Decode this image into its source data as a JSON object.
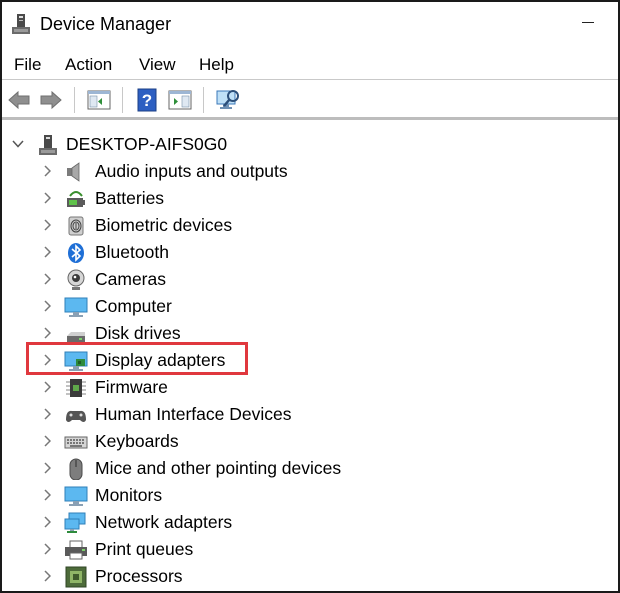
{
  "window": {
    "title": "Device Manager"
  },
  "menu": [
    {
      "key": "file",
      "label": "File"
    },
    {
      "key": "action",
      "label": "Action"
    },
    {
      "key": "view",
      "label": "View"
    },
    {
      "key": "help",
      "label": "Help"
    }
  ],
  "toolbar": [
    {
      "key": "back",
      "icon": "back-arrow-icon"
    },
    {
      "key": "forward",
      "icon": "forward-arrow-icon"
    },
    {
      "key": "show-hide-console-tree",
      "icon": "console-tree-icon"
    },
    {
      "key": "help",
      "icon": "help-icon"
    },
    {
      "key": "properties",
      "icon": "properties-icon"
    },
    {
      "key": "scan-for-hardware-changes",
      "icon": "scan-monitor-icon"
    }
  ],
  "tree": {
    "root": {
      "label": "DESKTOP-AIFS0G0",
      "expanded": true,
      "icon": "computer-tower-icon"
    },
    "items": [
      {
        "key": "audio",
        "label": "Audio inputs and outputs",
        "icon": "speaker-icon"
      },
      {
        "key": "batteries",
        "label": "Batteries",
        "icon": "battery-icon"
      },
      {
        "key": "biometric",
        "label": "Biometric devices",
        "icon": "fingerprint-icon"
      },
      {
        "key": "bluetooth",
        "label": "Bluetooth",
        "icon": "bluetooth-icon"
      },
      {
        "key": "cameras",
        "label": "Cameras",
        "icon": "camera-icon"
      },
      {
        "key": "computer",
        "label": "Computer",
        "icon": "monitor-icon"
      },
      {
        "key": "disk",
        "label": "Disk drives",
        "icon": "disk-drive-icon"
      },
      {
        "key": "display",
        "label": "Display adapters",
        "icon": "display-adapter-icon",
        "highlighted": true
      },
      {
        "key": "firmware",
        "label": "Firmware",
        "icon": "chip-icon"
      },
      {
        "key": "hid",
        "label": "Human Interface Devices",
        "icon": "hid-icon"
      },
      {
        "key": "keyboards",
        "label": "Keyboards",
        "icon": "keyboard-icon"
      },
      {
        "key": "mice",
        "label": "Mice and other pointing devices",
        "icon": "mouse-icon"
      },
      {
        "key": "monitors",
        "label": "Monitors",
        "icon": "monitor-icon"
      },
      {
        "key": "network",
        "label": "Network adapters",
        "icon": "network-adapter-icon"
      },
      {
        "key": "print",
        "label": "Print queues",
        "icon": "printer-icon"
      },
      {
        "key": "processors",
        "label": "Processors",
        "icon": "processor-icon"
      }
    ]
  },
  "colors": {
    "highlight": "#e0383e",
    "accent": "#1f6fd6"
  }
}
